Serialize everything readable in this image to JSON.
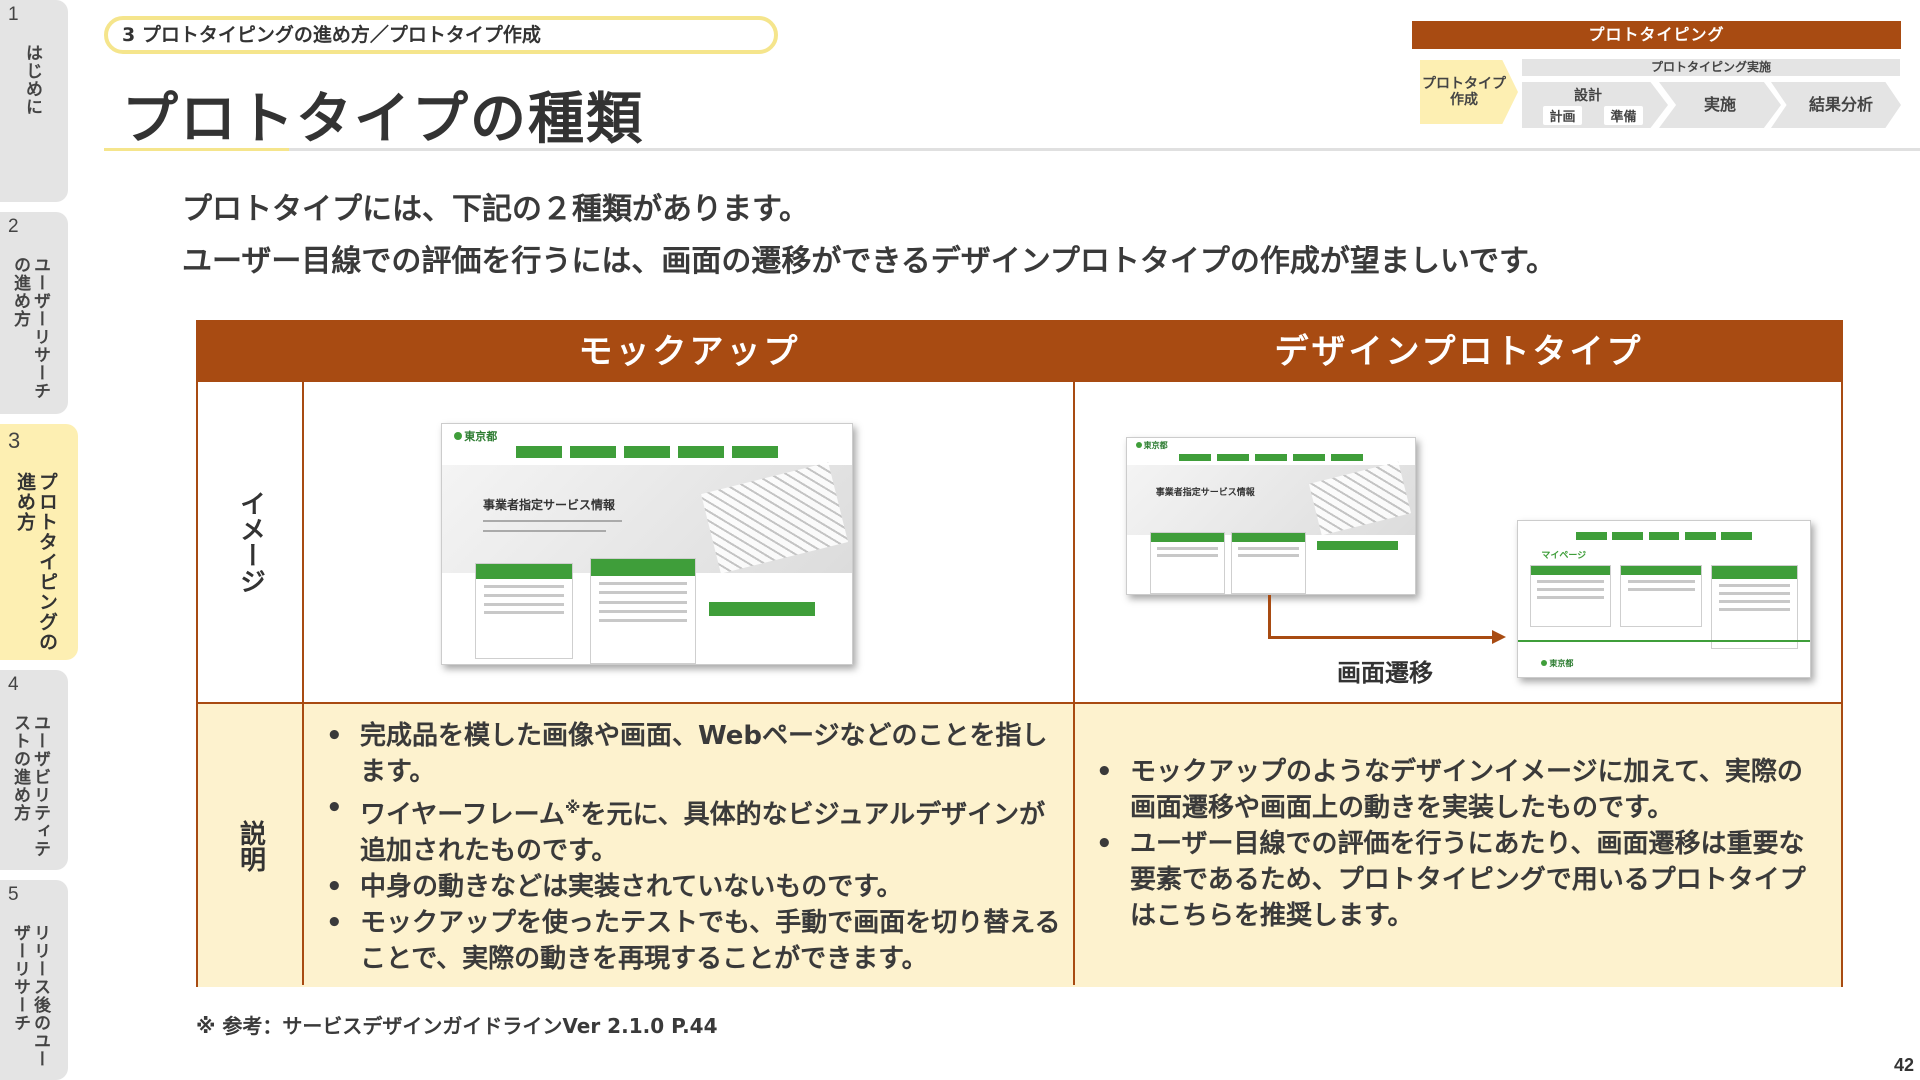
{
  "sidebar": {
    "tabs": [
      {
        "num": "1",
        "label": "はじめに"
      },
      {
        "num": "2",
        "label": "ユーザーリサーチの進め方"
      },
      {
        "num": "3",
        "label": "プロトタイピングの進め方"
      },
      {
        "num": "4",
        "label": "ユーザビリティテストの進め方"
      },
      {
        "num": "5",
        "label": "リリース後のユーザーリサーチ"
      }
    ],
    "active_index": 2
  },
  "header": {
    "breadcrumb": "3 プロトタイピングの進め方／プロトタイプ作成",
    "title": "プロトタイプの種類"
  },
  "process": {
    "bar": "プロトタイピング",
    "sub_bar": "プロトタイピング実施",
    "steps": {
      "prototype": "プロトタイプ作成",
      "design": "設計",
      "plan": "計画",
      "prep": "準備",
      "implement": "実施",
      "result": "結果分析"
    }
  },
  "lead": {
    "line1": "プロトタイプには、下記の２種類があります。",
    "line2": "ユーザー目線での評価を行うには、画面の遷移ができるデザインプロトタイプの作成が望ましいです。"
  },
  "table": {
    "col1_header": "モックアップ",
    "col2_header": "デザインプロトタイプ",
    "row1_label": "イメージ",
    "row2_label": "説明",
    "mockup_desc": [
      "完成品を模した画像や画面、Webページなどのことを指します。",
      "ワイヤーフレーム",
      "を元に、具体的なビジュアルデザインが追加されたものです。",
      "中身の動きなどは実装されていないものです。",
      "モックアップを使ったテストでも、手動で画面を切り替えることで、実際の動きを再現することができます。"
    ],
    "footnote_mark": "※",
    "prototype_desc": [
      "モックアップのようなデザインイメージに加えて、実際の画面遷移や画面上の動きを実装したものです。",
      "ユーザー目線での評価を行うにあたり、画面遷移は重要な要素であるため、プロトタイピングで用いるプロトタイプはこちらを推奨します。"
    ],
    "transition_label": "画面遷移"
  },
  "mock_site": {
    "logo": "東京都",
    "hero_title": "事業者指定サービス情報",
    "mypage": "マイページ"
  },
  "footnote": "※ 参考：サービスデザインガイドラインVer 2.1.0 P.44",
  "page_number": "42",
  "colors": {
    "accent": "#a84b12",
    "highlight": "#fdefb2",
    "desc_bg": "#fdf2ce",
    "site_green": "#3f9e3a"
  }
}
